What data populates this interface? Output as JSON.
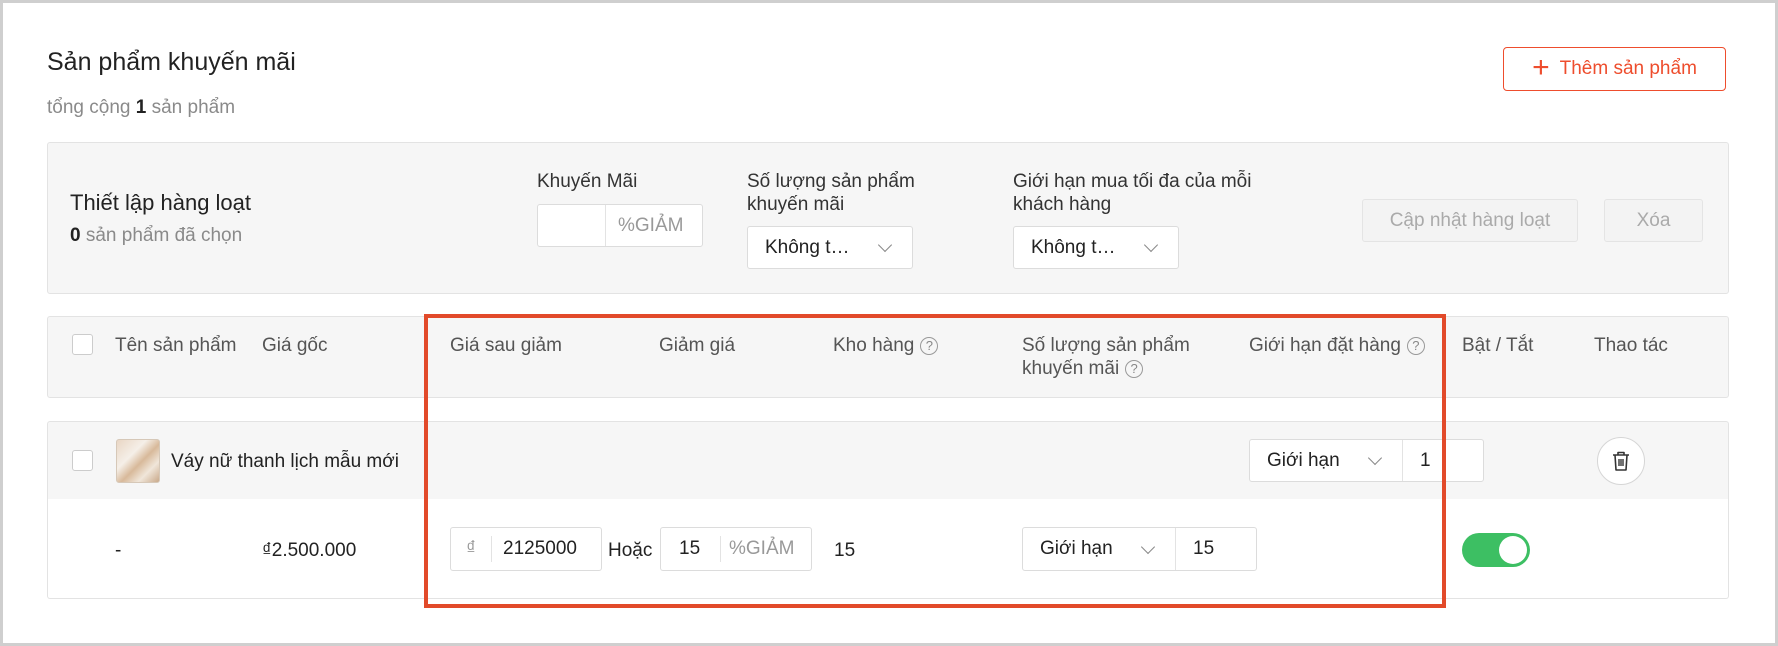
{
  "header": {
    "title": "Sản phẩm khuyến mãi",
    "total_prefix": "tổng cộng",
    "total_count": "1",
    "total_suffix": "sản phẩm",
    "add_button": "Thêm sản phẩm",
    "add_icon": "plus-icon"
  },
  "bulk": {
    "title": "Thiết lập hàng loạt",
    "selected_count": "0",
    "selected_suffix": "sản phẩm đã chọn",
    "discount_label": "Khuyến Mãi",
    "discount_value": "",
    "discount_unit": "%GIẢM",
    "qty_label_line1": "Số lượng sản phẩm",
    "qty_label_line2": "khuyến mãi",
    "qty_select": "Không t…",
    "limit_label_line1": "Giới hạn mua tối đa của mỗi",
    "limit_label_line2": "khách hàng",
    "limit_select": "Không t…",
    "update_button": "Cập nhật hàng loạt",
    "delete_button": "Xóa"
  },
  "table": {
    "headers": {
      "name": "Tên sản phẩm",
      "original_price": "Giá gốc",
      "sale_price": "Giá sau giảm",
      "discount": "Giảm giá",
      "stock": "Kho hàng",
      "promo_qty_line1": "Số lượng sản phẩm",
      "promo_qty_line2": "khuyến mãi",
      "order_limit": "Giới hạn đặt hàng",
      "toggle": "Bật / Tắt",
      "actions": "Thao tác"
    },
    "row": {
      "product_name": "Váy nữ thanh lịch mẫu mới",
      "order_limit_select": "Giới hạn",
      "order_limit_value": "1",
      "variation": "-",
      "original_price": "₫2.500.000",
      "currency": "₫",
      "sale_price": "2125000",
      "or_text": "Hoặc",
      "discount_value": "15",
      "discount_unit": "%GIẢM",
      "stock": "15",
      "promo_qty_select": "Giới hạn",
      "promo_qty_value": "15",
      "enabled": true
    }
  },
  "colors": {
    "accent": "#ee4d2d",
    "highlight": "#e24a2a",
    "toggle_on": "#3dbf63"
  }
}
